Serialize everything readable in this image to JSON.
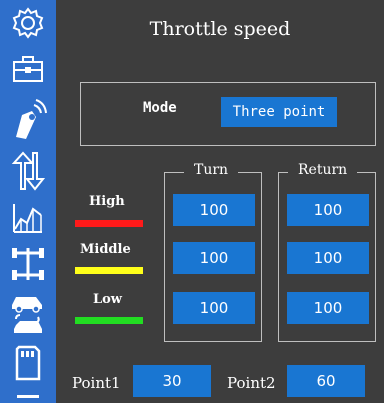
{
  "title": "Throttle speed",
  "sidebar": {
    "items": [
      {
        "icon": "gear-icon"
      },
      {
        "icon": "toolbox-icon"
      },
      {
        "icon": "transmitter-icon"
      },
      {
        "icon": "throttle-arrows-icon",
        "active": true
      },
      {
        "icon": "curve-chart-icon"
      },
      {
        "icon": "chassis-icon"
      },
      {
        "icon": "car-swap-icon"
      },
      {
        "icon": "sd-card-icon"
      },
      {
        "icon": "more-icon"
      }
    ]
  },
  "mode": {
    "label": "Mode",
    "value": "Three point"
  },
  "columns": {
    "turn": "Turn",
    "return": "Return"
  },
  "rows": [
    {
      "label": "High",
      "color": "#ff1a1a",
      "turn": "100",
      "return": "100"
    },
    {
      "label": "Middle",
      "color": "#ffff1a",
      "turn": "100",
      "return": "100"
    },
    {
      "label": "Low",
      "color": "#22dd22",
      "turn": "100",
      "return": "100"
    }
  ],
  "points": [
    {
      "label": "Point1",
      "value": "30"
    },
    {
      "label": "Point2",
      "value": "60"
    }
  ],
  "colors": {
    "sidebar": "#2f6fcb",
    "background": "#3d3d3d",
    "accent": "#1976d2",
    "active_item": "#ffffff"
  }
}
